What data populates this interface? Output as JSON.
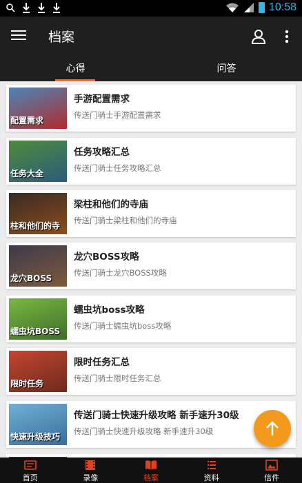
{
  "status_bar": {
    "time": "10:58"
  },
  "app_bar": {
    "title": "档案"
  },
  "tabs": [
    {
      "label": "心得",
      "active": true
    },
    {
      "label": "问答",
      "active": false
    }
  ],
  "list": [
    {
      "title": "手游配置需求",
      "subtitle": "传送门骑士手游配置需求",
      "thumb_text": "配置需求",
      "thumb_bg": [
        "#4a86b8",
        "#b22b2b"
      ]
    },
    {
      "title": "任务攻略汇总",
      "subtitle": "传送门骑士任务攻略汇总",
      "thumb_text": "任务大全",
      "thumb_bg": [
        "#4f8b3a",
        "#2a5c7d"
      ]
    },
    {
      "title": "梁柱和他们的寺庙",
      "subtitle": "传送门骑士梁柱和他们的寺庙",
      "thumb_text": "柱和他们的寺",
      "thumb_bg": [
        "#3a2a20",
        "#8a4e1f"
      ]
    },
    {
      "title": "龙穴BOSS攻略",
      "subtitle": "传送门骑士龙穴BOSS攻略",
      "thumb_text": "龙穴BOSS",
      "thumb_bg": [
        "#3d3a4a",
        "#7d5a3c"
      ]
    },
    {
      "title": "蠕虫坑boss攻略",
      "subtitle": "传送门骑士蠕虫坑boss攻略",
      "thumb_text": "蠕虫坑BOSS",
      "thumb_bg": [
        "#7ab840",
        "#3f6d2a"
      ]
    },
    {
      "title": "限时任务汇总",
      "subtitle": "传送门骑士限时任务汇总",
      "thumb_text": "限时任务",
      "thumb_bg": [
        "#c2462e",
        "#6e2a1f"
      ]
    },
    {
      "title": "传送门骑士快速升级攻略 新手速升30级",
      "subtitle": "传送门骑士快速升级攻略 新手速升30级",
      "thumb_text": "快速升级技巧",
      "thumb_bg": [
        "#6fb0d6",
        "#3a6e9a"
      ]
    }
  ],
  "bottom_nav": [
    {
      "label": "首页",
      "active": false
    },
    {
      "label": "录像",
      "active": false
    },
    {
      "label": "档案",
      "active": true
    },
    {
      "label": "资料",
      "active": false
    },
    {
      "label": "信件",
      "active": false
    }
  ],
  "colors": {
    "accent": "#e3411d",
    "tab_indicator": "#f56a2b",
    "fab": "#f39a1d",
    "app_bar": "#1f1f1f"
  }
}
